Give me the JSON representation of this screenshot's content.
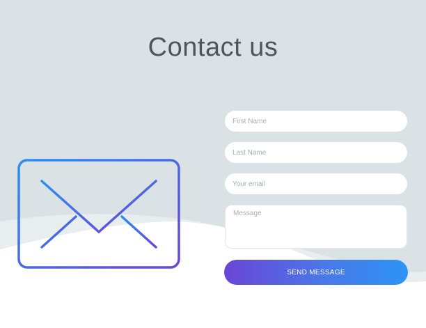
{
  "header": {
    "title": "Contact us"
  },
  "form": {
    "first_name": {
      "placeholder": "First Name",
      "value": ""
    },
    "last_name": {
      "placeholder": "Last Name",
      "value": ""
    },
    "email": {
      "placeholder": "Your email",
      "value": ""
    },
    "message": {
      "placeholder": "Message",
      "value": ""
    },
    "submit_label": "SEND MESSAGE"
  },
  "colors": {
    "background": "#dbe2e6",
    "accent_start": "#6a45d6",
    "accent_end": "#2c94f5",
    "title_text": "#4f5559"
  },
  "icons": {
    "envelope": "envelope-icon"
  }
}
